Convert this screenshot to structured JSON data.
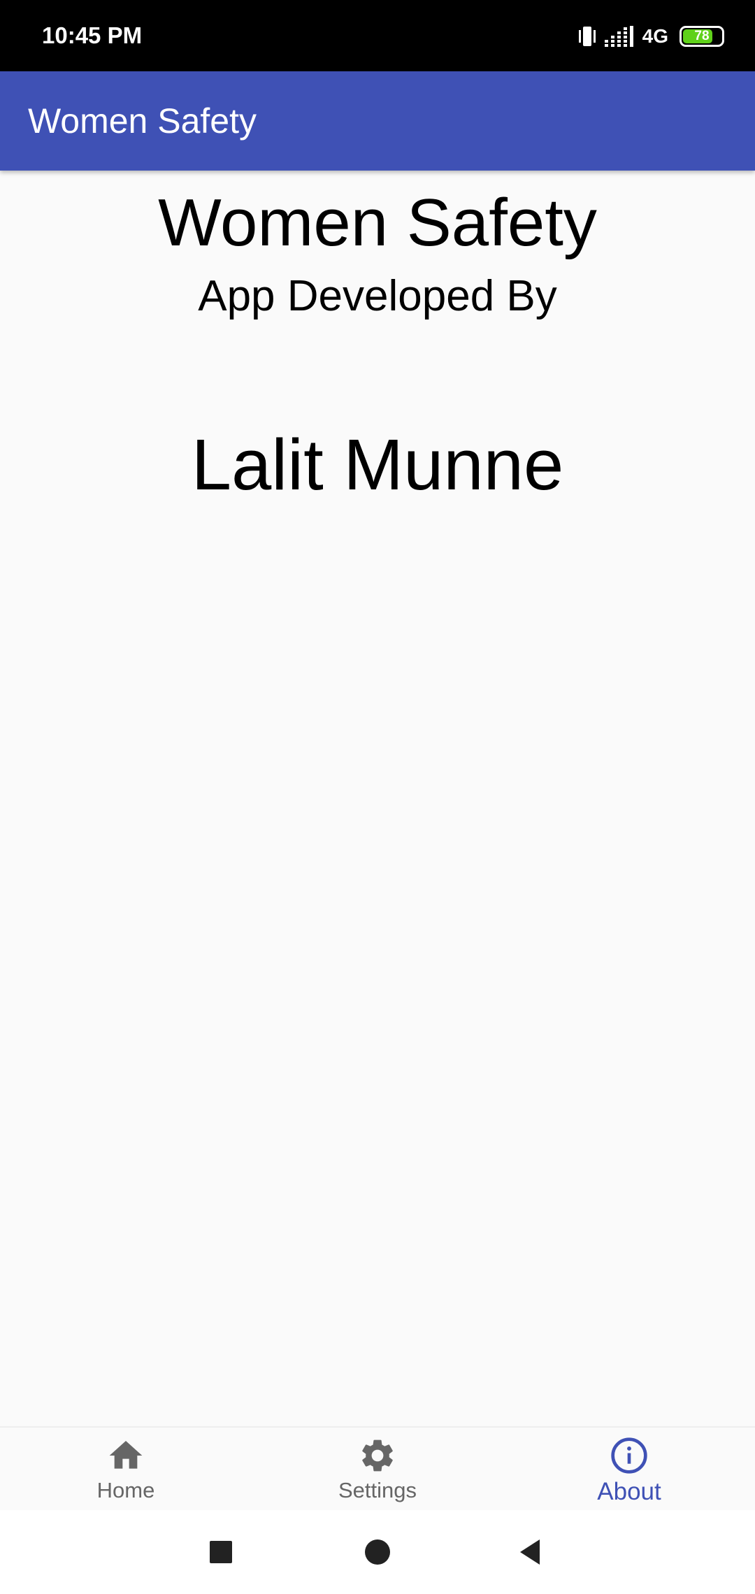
{
  "status_bar": {
    "time": "10:45 PM",
    "network": "4G",
    "battery_level": "78",
    "battery_fraction": 0.78,
    "icons": [
      "vibrate-icon",
      "signal-icon",
      "battery-icon"
    ]
  },
  "app_bar": {
    "title": "Women Safety"
  },
  "content": {
    "title": "Women Safety",
    "subtitle": "App Developed By",
    "developer": "Lalit Munne"
  },
  "bottom_nav": {
    "items": [
      {
        "label": "Home",
        "icon": "home-icon",
        "active": false
      },
      {
        "label": "Settings",
        "icon": "gear-icon",
        "active": false
      },
      {
        "label": "About",
        "icon": "info-icon",
        "active": true
      }
    ]
  },
  "system_nav": {
    "buttons": [
      "recents-icon",
      "home-circle-icon",
      "back-icon"
    ]
  },
  "colors": {
    "primary": "#3f51b5",
    "status_bar": "#000000",
    "background": "#fafafa",
    "inactive": "#666666",
    "battery": "#5fd11a"
  }
}
